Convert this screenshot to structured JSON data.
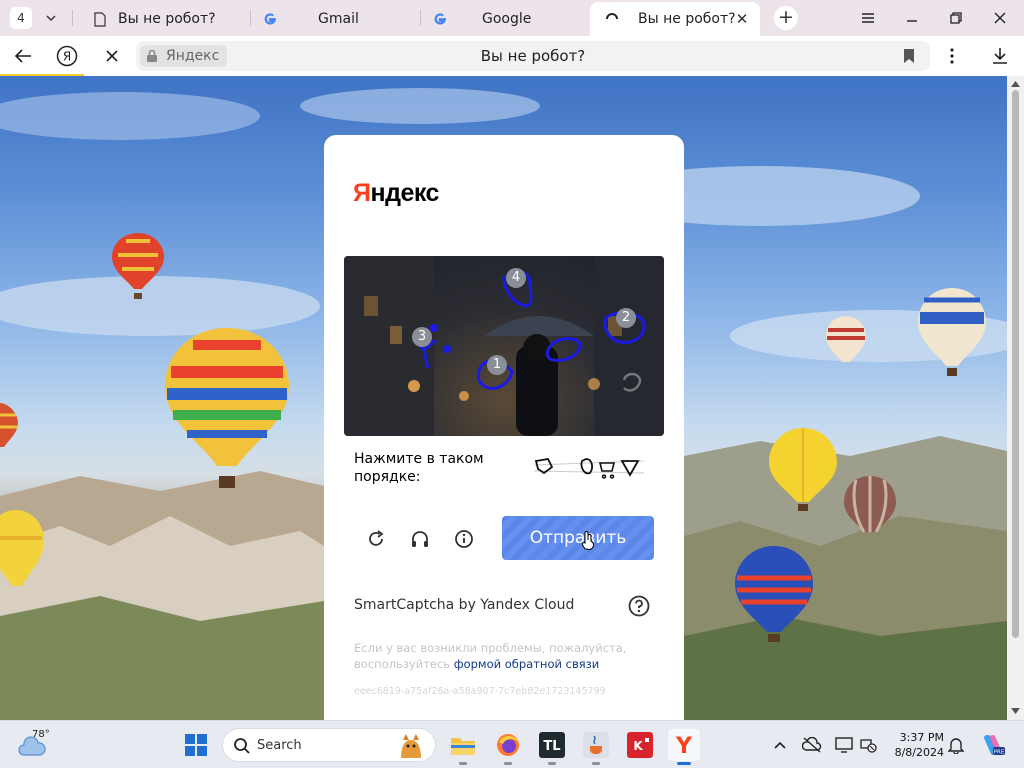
{
  "browser": {
    "tab_count": "4",
    "tabs": [
      {
        "title": "Вы не робот?",
        "favicon": "page-icon",
        "active": false
      },
      {
        "title": "Gmail",
        "favicon": "google-g-icon",
        "active": false
      },
      {
        "title": "Google",
        "favicon": "google-g-icon",
        "active": false
      },
      {
        "title": "Вы не робот?",
        "favicon": "loading-spinner-icon",
        "active": true
      }
    ],
    "site_chip": "Яндекс",
    "omnibox_title": "Вы не робот?"
  },
  "captcha": {
    "logo_first": "Я",
    "logo_rest": "ндекс",
    "markers": [
      "1",
      "2",
      "3",
      "4"
    ],
    "instruction": "Нажмите в таком порядке:",
    "submit_label": "Отправить",
    "brand_line": "SmartCaptcha by Yandex Cloud",
    "feedback_text": "Если у вас возникли проблемы, пожалуйста, воспользуйтесь",
    "feedback_link": "формой обратной связи",
    "request_id": "eeec6819-a75af26a-a58a907-7c7eb82e1723145799"
  },
  "taskbar": {
    "weather_temp": "78°",
    "search_label": "Search",
    "clock_time": "3:37 PM",
    "clock_date": "8/8/2024",
    "apps": [
      "file-explorer-icon",
      "firefox-icon",
      "tl-app-icon",
      "java-icon",
      "k-app-icon",
      "yandex-browser-icon"
    ]
  },
  "colors": {
    "yandex_red": "#fc3f1d",
    "submit_blue": "#5b86ea",
    "marker_blue": "#1a1ae6",
    "loading_yellow": "#f7cc2e"
  }
}
